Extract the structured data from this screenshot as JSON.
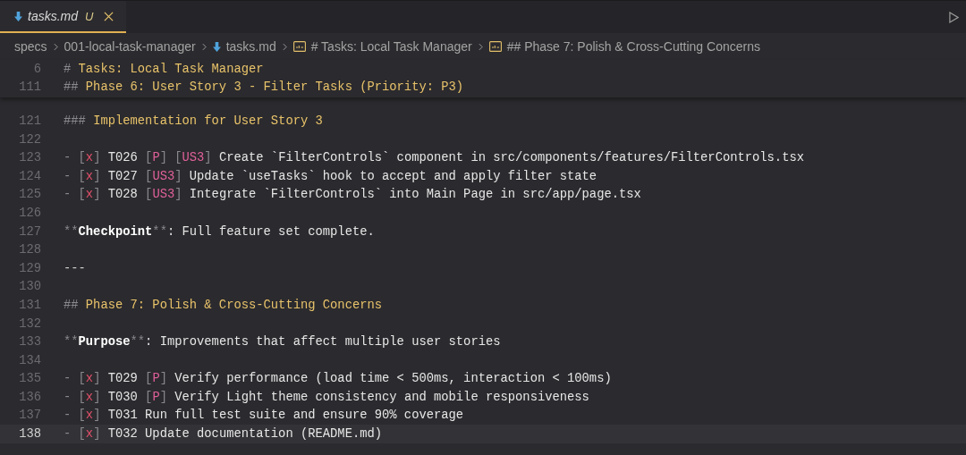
{
  "tab": {
    "label": "tasks.md",
    "status": "U",
    "selected": true
  },
  "breadcrumbs": [
    {
      "kind": "folder",
      "label": "specs"
    },
    {
      "kind": "folder",
      "label": "001-local-task-manager"
    },
    {
      "kind": "file",
      "label": "tasks.md"
    },
    {
      "kind": "heading",
      "label": "# Tasks: Local Task Manager"
    },
    {
      "kind": "heading",
      "label": "## Phase 7: Polish & Cross-Cutting Concerns"
    }
  ],
  "sticky_lines": [
    {
      "number": "6",
      "current": false,
      "segments": [
        {
          "kind": "mark",
          "text": "# "
        },
        {
          "kind": "heading",
          "text": "Tasks: Local Task Manager"
        }
      ]
    },
    {
      "number": "111",
      "current": false,
      "segments": [
        {
          "kind": "mark",
          "text": "## "
        },
        {
          "kind": "heading",
          "text": "Phase 6: User Story 3 - Filter Tasks (Priority: P3)"
        }
      ]
    }
  ],
  "lines": [
    {
      "number": "121",
      "current": false,
      "segments": [
        {
          "kind": "mark",
          "text": "### "
        },
        {
          "kind": "heading",
          "text": "Implementation for User Story 3"
        }
      ]
    },
    {
      "number": "122",
      "current": false
    },
    {
      "number": "123",
      "current": false,
      "segments": [
        {
          "kind": "mark",
          "text": "- ["
        },
        {
          "kind": "check",
          "text": "x"
        },
        {
          "kind": "mark",
          "text": "] "
        },
        {
          "kind": "text",
          "text": "T026 "
        },
        {
          "kind": "mark",
          "text": "["
        },
        {
          "kind": "tag",
          "text": "P"
        },
        {
          "kind": "mark",
          "text": "] ["
        },
        {
          "kind": "tag",
          "text": "US3"
        },
        {
          "kind": "mark",
          "text": "] "
        },
        {
          "kind": "text",
          "text": "Create `FilterControls` component in src/components/features/FilterControls.tsx"
        }
      ]
    },
    {
      "number": "124",
      "current": false,
      "segments": [
        {
          "kind": "mark",
          "text": "- ["
        },
        {
          "kind": "check",
          "text": "x"
        },
        {
          "kind": "mark",
          "text": "] "
        },
        {
          "kind": "text",
          "text": "T027 "
        },
        {
          "kind": "mark",
          "text": "["
        },
        {
          "kind": "tag",
          "text": "US3"
        },
        {
          "kind": "mark",
          "text": "] "
        },
        {
          "kind": "text",
          "text": "Update `useTasks` hook to accept and apply filter state"
        }
      ]
    },
    {
      "number": "125",
      "current": false,
      "segments": [
        {
          "kind": "mark",
          "text": "- ["
        },
        {
          "kind": "check",
          "text": "x"
        },
        {
          "kind": "mark",
          "text": "] "
        },
        {
          "kind": "text",
          "text": "T028 "
        },
        {
          "kind": "mark",
          "text": "["
        },
        {
          "kind": "tag",
          "text": "US3"
        },
        {
          "kind": "mark",
          "text": "] "
        },
        {
          "kind": "text",
          "text": "Integrate `FilterControls` into Main Page in src/app/page.tsx"
        }
      ]
    },
    {
      "number": "126",
      "current": false
    },
    {
      "number": "127",
      "current": false,
      "segments": [
        {
          "kind": "mark",
          "text": "**"
        },
        {
          "kind": "bold",
          "text": "Checkpoint"
        },
        {
          "kind": "mark",
          "text": "**"
        },
        {
          "kind": "text",
          "text": ": Full feature set complete."
        }
      ]
    },
    {
      "number": "128",
      "current": false
    },
    {
      "number": "129",
      "current": false,
      "segments": [
        {
          "kind": "rule",
          "text": "---"
        }
      ]
    },
    {
      "number": "130",
      "current": false
    },
    {
      "number": "131",
      "current": false,
      "segments": [
        {
          "kind": "mark",
          "text": "## "
        },
        {
          "kind": "heading",
          "text": "Phase 7: Polish & Cross-Cutting Concerns"
        }
      ]
    },
    {
      "number": "132",
      "current": false
    },
    {
      "number": "133",
      "current": false,
      "segments": [
        {
          "kind": "mark",
          "text": "**"
        },
        {
          "kind": "bold",
          "text": "Purpose"
        },
        {
          "kind": "mark",
          "text": "**"
        },
        {
          "kind": "text",
          "text": ": Improvements that affect multiple user stories"
        }
      ]
    },
    {
      "number": "134",
      "current": false
    },
    {
      "number": "135",
      "current": false,
      "segments": [
        {
          "kind": "mark",
          "text": "- ["
        },
        {
          "kind": "check",
          "text": "x"
        },
        {
          "kind": "mark",
          "text": "] "
        },
        {
          "kind": "text",
          "text": "T029 "
        },
        {
          "kind": "mark",
          "text": "["
        },
        {
          "kind": "tag",
          "text": "P"
        },
        {
          "kind": "mark",
          "text": "] "
        },
        {
          "kind": "text",
          "text": "Verify performance (load time < 500ms, interaction < 100ms)"
        }
      ]
    },
    {
      "number": "136",
      "current": false,
      "segments": [
        {
          "kind": "mark",
          "text": "- ["
        },
        {
          "kind": "check",
          "text": "x"
        },
        {
          "kind": "mark",
          "text": "] "
        },
        {
          "kind": "text",
          "text": "T030 "
        },
        {
          "kind": "mark",
          "text": "["
        },
        {
          "kind": "tag",
          "text": "P"
        },
        {
          "kind": "mark",
          "text": "] "
        },
        {
          "kind": "text",
          "text": "Verify Light theme consistency and mobile responsiveness"
        }
      ]
    },
    {
      "number": "137",
      "current": false,
      "segments": [
        {
          "kind": "mark",
          "text": "- ["
        },
        {
          "kind": "check",
          "text": "x"
        },
        {
          "kind": "mark",
          "text": "] "
        },
        {
          "kind": "text",
          "text": "T031 Run full test suite and ensure 90% coverage"
        }
      ]
    },
    {
      "number": "138",
      "current": true,
      "segments": [
        {
          "kind": "mark",
          "text": "- ["
        },
        {
          "kind": "check",
          "text": "x"
        },
        {
          "kind": "mark",
          "text": "] "
        },
        {
          "kind": "text",
          "text": "T032 Update documentation (README.md)"
        }
      ]
    }
  ]
}
